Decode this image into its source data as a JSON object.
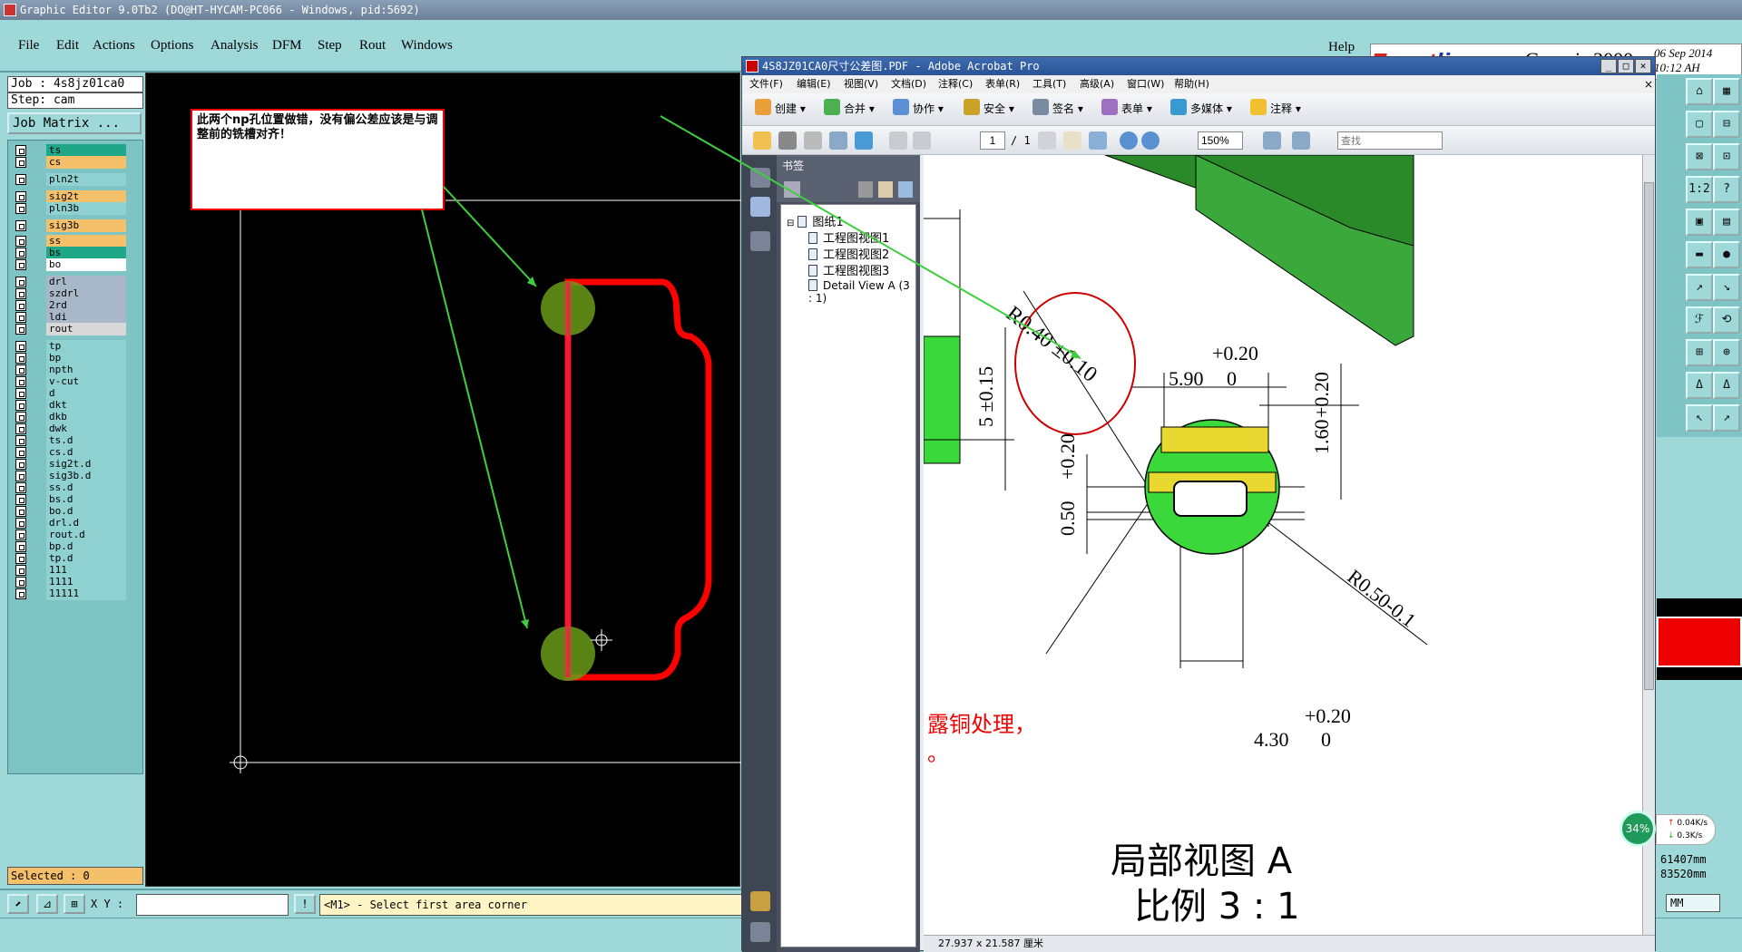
{
  "genesis": {
    "title": "Graphic Editor 9.0Tb2 (DO@HT-HYCAM-PC066 - Windows, pid:5692)",
    "menu": [
      "File",
      "Edit",
      "Actions",
      "Options",
      "Analysis",
      "DFM",
      "Step",
      "Rout",
      "Windows"
    ],
    "help": "Help",
    "brand": {
      "frontline_a": "Front",
      "frontline_b": "line",
      "product": "Genesis 2000",
      "date": "06 Sep 2014",
      "time": "10:12 AH"
    },
    "job": "Job : 4s8jz01ca0",
    "step": "Step: cam",
    "job_matrix": "Job Matrix ...",
    "selected": "Selected : 0",
    "xy_label": "X Y :",
    "xy_value": "",
    "prompt": "<M1> - Select first area corner",
    "readout": [
      "61407mm",
      "83520mm"
    ],
    "units": "MM",
    "annotation": "此两个np孔位置做错，没有偏公差应该是与调整前的铣槽对齐！",
    "layers": [
      {
        "name": "ts",
        "color": "#1fa888"
      },
      {
        "name": "cs",
        "color": "#f4c06a"
      },
      {
        "name": "pln2t",
        "color": "#8fd0d0"
      },
      {
        "name": "sig2t",
        "color": "#f4c06a"
      },
      {
        "name": "pln3b",
        "color": "#8fd0d0"
      },
      {
        "name": "sig3b",
        "color": "#f4c06a"
      },
      {
        "name": "ss",
        "color": "#f4c06a"
      },
      {
        "name": "bs",
        "color": "#1fa888"
      },
      {
        "name": "bo",
        "color": "#ffffff"
      },
      {
        "name": "drl",
        "color": "#a8b8c8"
      },
      {
        "name": "szdrl",
        "color": "#a8b8c8"
      },
      {
        "name": "2rd",
        "color": "#a8b8c8"
      },
      {
        "name": "ldi",
        "color": "#a8b8c8"
      },
      {
        "name": "rout",
        "color": "#d8d8d8"
      },
      {
        "name": "tp",
        "color": "#8fd0d0"
      },
      {
        "name": "bp",
        "color": "#8fd0d0"
      },
      {
        "name": "npth",
        "color": "#8fd0d0"
      },
      {
        "name": "v-cut",
        "color": "#8fd0d0"
      },
      {
        "name": "d",
        "color": "#8fd0d0"
      },
      {
        "name": "dkt",
        "color": "#8fd0d0"
      },
      {
        "name": "dkb",
        "color": "#8fd0d0"
      },
      {
        "name": "dwk",
        "color": "#8fd0d0"
      },
      {
        "name": "ts.d",
        "color": "#8fd0d0"
      },
      {
        "name": "cs.d",
        "color": "#8fd0d0"
      },
      {
        "name": "sig2t.d",
        "color": "#8fd0d0"
      },
      {
        "name": "sig3b.d",
        "color": "#8fd0d0"
      },
      {
        "name": "ss.d",
        "color": "#8fd0d0"
      },
      {
        "name": "bs.d",
        "color": "#8fd0d0"
      },
      {
        "name": "bo.d",
        "color": "#8fd0d0"
      },
      {
        "name": "drl.d",
        "color": "#8fd0d0"
      },
      {
        "name": "rout.d",
        "color": "#8fd0d0"
      },
      {
        "name": "bp.d",
        "color": "#8fd0d0"
      },
      {
        "name": "tp.d",
        "color": "#8fd0d0"
      },
      {
        "name": "111",
        "color": "#8fd0d0"
      },
      {
        "name": "1111",
        "color": "#8fd0d0"
      },
      {
        "name": "11111",
        "color": "#8fd0d0"
      }
    ],
    "tool_glyphs": [
      "⌂",
      "▦",
      "▢",
      "⊟",
      "⊠",
      "⊡",
      "1:2",
      "?",
      "▣",
      "▤",
      "▬",
      "●",
      "↗",
      "↘",
      "ℱ",
      "⟲",
      "⊞",
      "⊕",
      "Δ",
      "Δ",
      "↖",
      "↗"
    ]
  },
  "acrobat": {
    "title": "4S8JZ01CA0尺寸公差图.PDF - Adobe Acrobat Pro",
    "menu": [
      "文件(F)",
      "编辑(E)",
      "视图(V)",
      "文档(D)",
      "注释(C)",
      "表单(R)",
      "工具(T)",
      "高级(A)",
      "窗口(W)",
      "帮助(H)"
    ],
    "tasks": [
      "创建",
      "合并",
      "协作",
      "安全",
      "签名",
      "表单",
      "多媒体",
      "注释"
    ],
    "page_current": "1",
    "page_total": "/ 1",
    "zoom": "150%",
    "find_placeholder": "查找",
    "bookmarks_title": "书签",
    "bookmarks": [
      "图纸1",
      "工程图视图1",
      "工程图视图2",
      "工程图视图3",
      "Detail View A (3 : 1)"
    ],
    "page_size": "27.937 x 21.587 厘米",
    "drawing": {
      "r040": "R0.40 ±0.10",
      "tol_a": "+0.20",
      "val_590": "5.90",
      "zero": "0",
      "val_5": "5 ±0.15",
      "val_160": "1.60",
      "val_050": "0.50",
      "r050": "R0.50-0.1",
      "val_430": "4.30",
      "red_note": "露铜处理，",
      "red_note2": "。",
      "view_title": "局部视图 A",
      "view_scale": "比例 3 : 1"
    }
  },
  "network": {
    "percent": "34%",
    "up": "0.04K/s",
    "down": "0.3K/s"
  }
}
